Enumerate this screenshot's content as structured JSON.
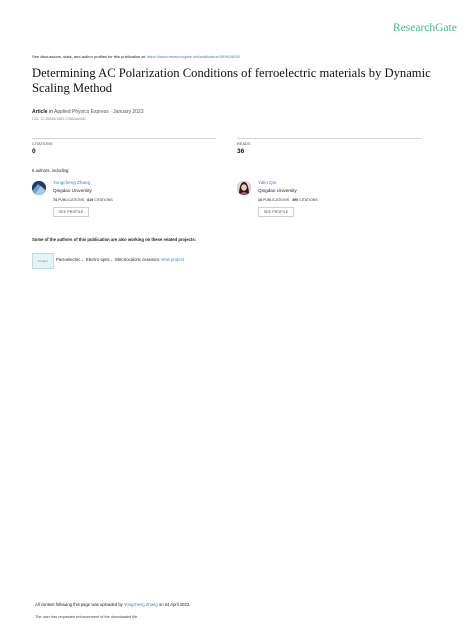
{
  "header": {
    "logo": "ResearchGate"
  },
  "discussion": {
    "prefix": "See discussions, stats, and author profiles for this publication at: ",
    "url": "https://www.researchgate.net/publication/369616830"
  },
  "publication": {
    "title": "Determining AC Polarization Conditions of ferroelectric materials by Dynamic Scaling Method",
    "type": "Article",
    "in_word": "in",
    "journal": "Applied Physics Express · January 2023",
    "doi": "DOI: 10.35848/1882-0786/acc5d2"
  },
  "stats": {
    "citations_label": "CITATIONS",
    "citations_value": "0",
    "reads_label": "READS",
    "reads_value": "36"
  },
  "authors": {
    "heading": "6 authors, including:",
    "list": [
      {
        "name": "Yongcheng Zhang",
        "institution": "Qingdao University",
        "publications": "74",
        "publications_label": "PUBLICATIONS",
        "citations": "819",
        "citations_label": "CITATIONS",
        "button": "SEE PROFILE"
      },
      {
        "name": "Yalin Qin",
        "institution": "Qingdao University",
        "publications": "10",
        "publications_label": "PUBLICATIONS",
        "citations": "390",
        "citations_label": "CITATIONS",
        "button": "SEE PROFILE"
      }
    ]
  },
  "projects": {
    "heading": "Some of the authors of this publication are also working on these related projects:",
    "thumb_label": "Project",
    "text": "Piezoelectric 、Electro-optic 、Electrocaloric ceramics",
    "link": "View project"
  },
  "footer": {
    "uploaded_prefix": "All content following this page was uploaded by",
    "uploader": "Yongcheng Zhang",
    "uploaded_suffix": "on 04 April 2023.",
    "note": "The user has requested enhancement of the downloaded file."
  },
  "colors": {
    "brand": "#40ba9b",
    "link": "#3b7dd8",
    "rule": "#d4d4d4"
  }
}
